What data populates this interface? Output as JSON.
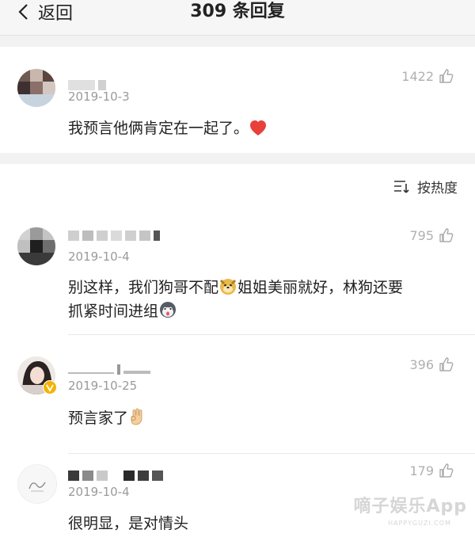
{
  "header": {
    "back_label": "返回",
    "title": "309 条回复"
  },
  "top_comment": {
    "date": "2019-10-3",
    "likes": "1422",
    "text": "我预言他俩肯定在一起了。"
  },
  "sort": {
    "label": "按热度"
  },
  "comments": [
    {
      "date": "2019-10-4",
      "likes": "795",
      "text_a": "别这样，我们狗哥不配",
      "text_b": "姐姐美丽就好，林狗还要",
      "text_c": "抓紧时间进组"
    },
    {
      "date": "2019-10-25",
      "likes": "396",
      "text": "预言家了"
    },
    {
      "date": "2019-10-4",
      "likes": "179",
      "text": "很明显，是对情头"
    }
  ],
  "watermark": {
    "text": "嘀子娱乐App",
    "sub": "HAPPYGUZI.COM"
  },
  "colors": {
    "heart": "#e8403a",
    "verified_badge": "#f3b400",
    "divider": "#e8e8e8"
  }
}
